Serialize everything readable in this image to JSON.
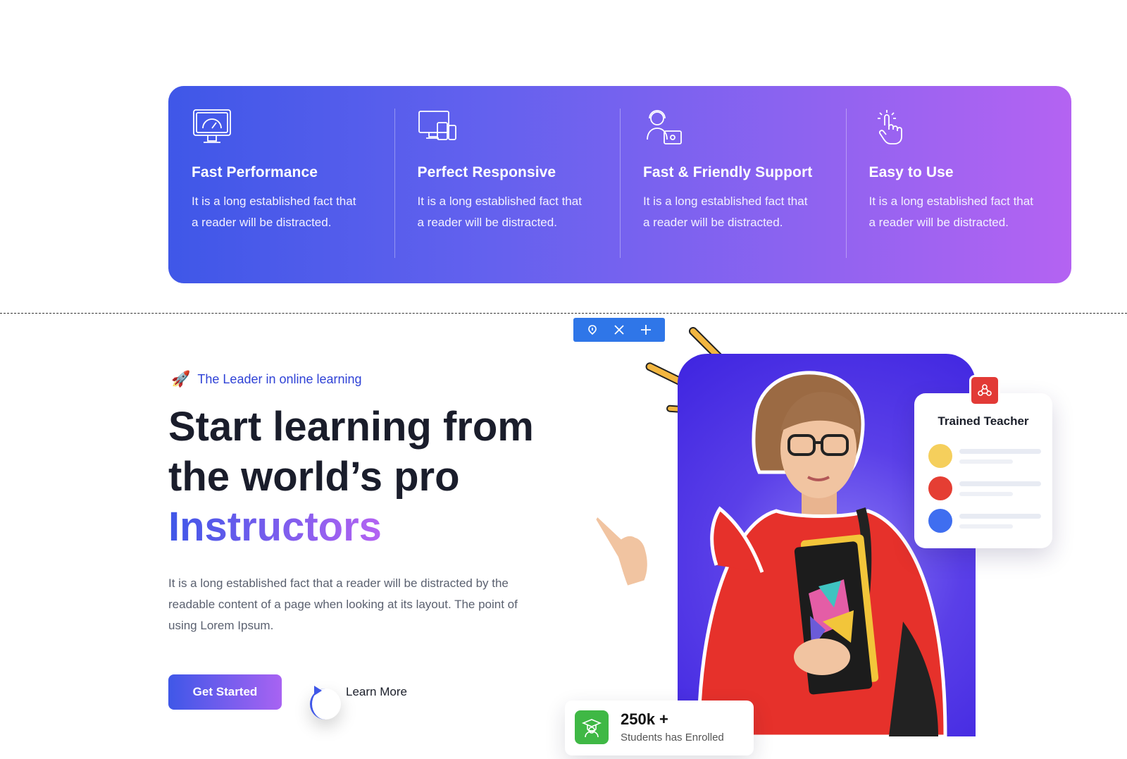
{
  "features": [
    {
      "icon": "speedometer-monitor-icon",
      "title": "Fast Performance",
      "text": "It is a long established fact that a reader will be distracted."
    },
    {
      "icon": "responsive-devices-icon",
      "title": "Perfect Responsive",
      "text": "It is a long established fact that a reader will be distracted."
    },
    {
      "icon": "support-agent-icon",
      "title": "Fast & Friendly Support",
      "text": "It is a long established fact that a reader will be distracted."
    },
    {
      "icon": "tap-hand-icon",
      "title": "Easy to Use",
      "text": "It is a long established fact that a reader will be distracted."
    }
  ],
  "editor_toolbar": {
    "icons": [
      "drag-handle-icon",
      "close-icon",
      "plus-icon"
    ]
  },
  "hero": {
    "tagline": "The Leader in online learning",
    "title_line1": "Start learning from",
    "title_line2": "the world’s pro",
    "title_highlight": "Instructors",
    "description": "It is a long established fact that a reader will be distracted by the readable content of a page when looking at its layout. The point of using Lorem Ipsum.",
    "cta_primary": "Get Started",
    "cta_secondary": "Learn More"
  },
  "teacher_card": {
    "title": "Trained Teacher",
    "dots": [
      "#f5cf5c",
      "#e53e33",
      "#3f6ef0"
    ]
  },
  "enrolled": {
    "count": "250k +",
    "label": "Students has Enrolled"
  },
  "colors": {
    "gradient_start": "#3f57e8",
    "gradient_end": "#b463f2",
    "tagline": "#2f42d6"
  }
}
